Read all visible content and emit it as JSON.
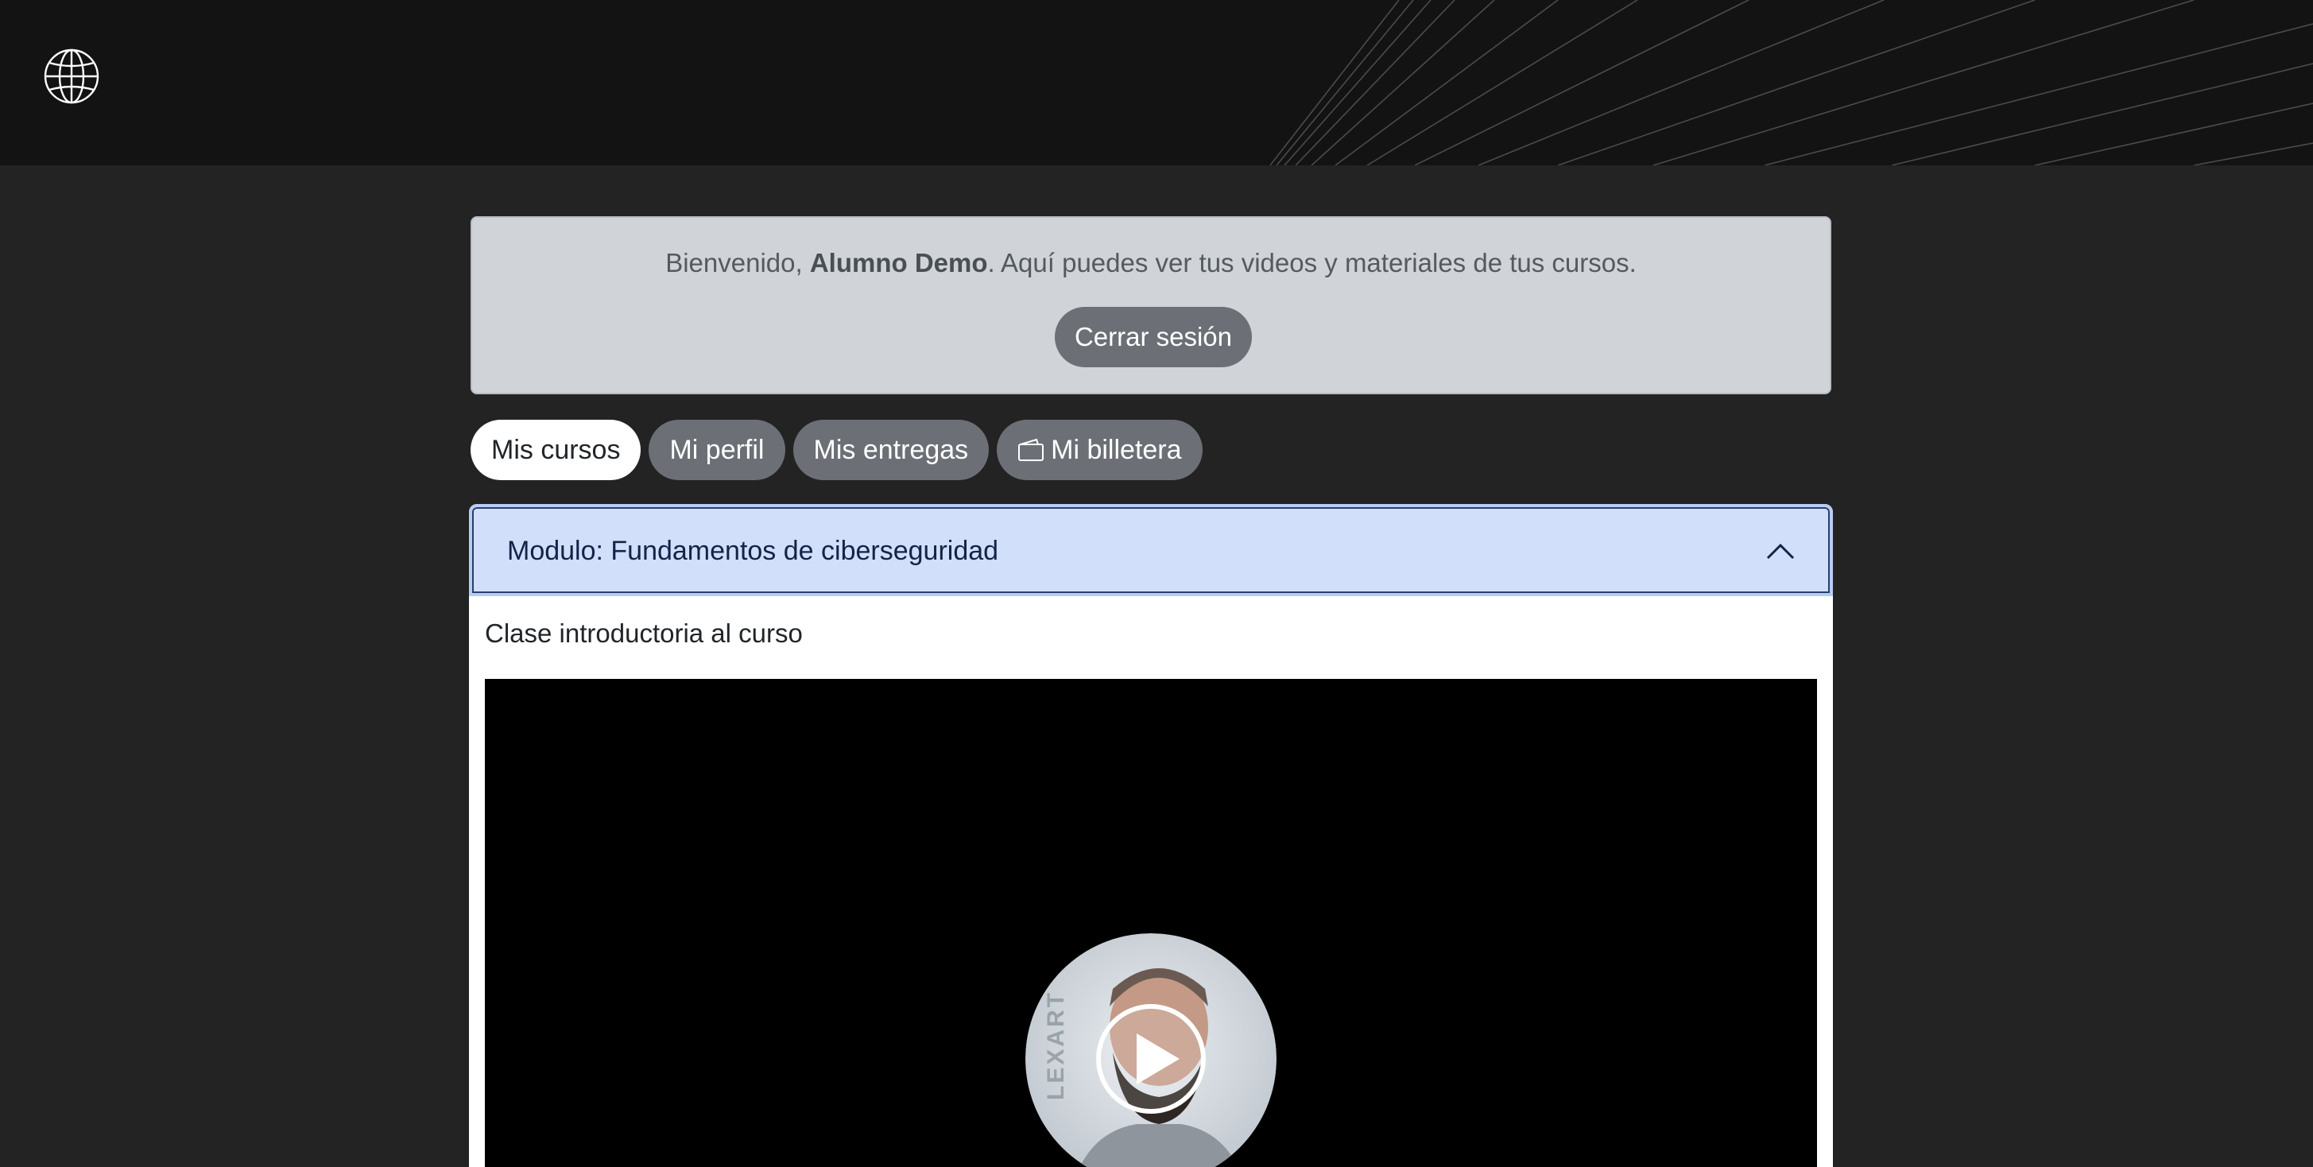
{
  "header": {
    "logo_icon": "globe-icon"
  },
  "welcome": {
    "greeting_prefix": "Bienvenido, ",
    "user_name": "Alumno Demo",
    "greeting_suffix": ". Aquí puedes ver tus videos y materiales de tus cursos.",
    "logout_label": "Cerrar sesión"
  },
  "tabs": [
    {
      "label": "Mis cursos",
      "active": true
    },
    {
      "label": "Mi perfil",
      "active": false
    },
    {
      "label": "Mis entregas",
      "active": false
    },
    {
      "label": "Mi billetera",
      "active": false,
      "icon": "wallet-icon"
    }
  ],
  "module": {
    "title": "Modulo: Fundamentos de ciberseguridad",
    "expanded": true,
    "toggle_icon": "chevron-up-icon"
  },
  "lesson": {
    "title": "Clase introductoria al curso",
    "video_thumbnail_watermark": "LEXART",
    "play_icon": "play-icon"
  },
  "colors": {
    "topbar": "#131313",
    "page_bg": "#232323",
    "welcome_bg": "#d0d4d8",
    "tab_bg": "#6c7076",
    "accordion_header_bg": "#d1dffb"
  }
}
